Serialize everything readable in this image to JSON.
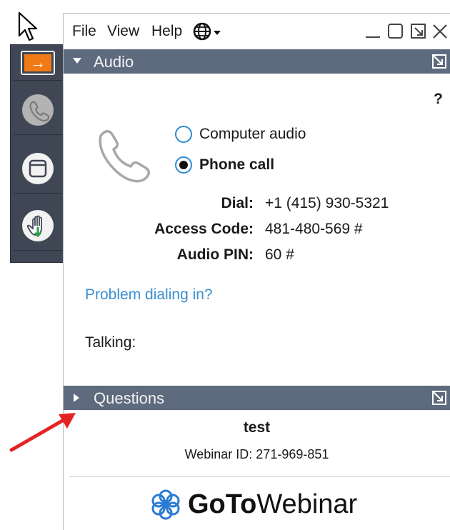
{
  "menubar": {
    "file": "File",
    "view": "View",
    "help": "Help"
  },
  "audio_panel": {
    "title": "Audio",
    "help_label": "?",
    "options": [
      {
        "label": "Computer audio",
        "selected": false
      },
      {
        "label": "Phone call",
        "selected": true
      }
    ],
    "details": [
      {
        "label": "Dial:",
        "value": "+1 (415) 930-5321"
      },
      {
        "label": "Access Code:",
        "value": "481-480-569 #"
      },
      {
        "label": "Audio PIN:",
        "value": "60 #"
      }
    ],
    "problem_link": "Problem dialing in?",
    "talking_label": "Talking:"
  },
  "questions_panel": {
    "title": "Questions"
  },
  "footer": {
    "webinar_name": "test",
    "webinar_id": "Webinar ID: 271-969-851",
    "logo_part1": "GoTo",
    "logo_part2": "Webinar"
  },
  "colors": {
    "panel_header": "#5e6a7e",
    "strip_bg": "#3f4654",
    "accent_orange": "#f07b16",
    "link_blue": "#3a8fd0",
    "radio_border": "#2d8ccf",
    "annotation_red": "#e52323"
  },
  "icons": {
    "cursor": "mouse-pointer-icon",
    "strip": [
      "arrow-right-icon",
      "phone-icon",
      "window-icon",
      "raise-hand-icon"
    ],
    "globe": "globe-icon",
    "window_controls": [
      "minimize-icon",
      "maximize-icon",
      "restore-icon",
      "close-icon"
    ],
    "phone_large": "phone-icon",
    "logo": "gotowebinar-flower-icon",
    "annotation": "red-arrow-icon"
  }
}
